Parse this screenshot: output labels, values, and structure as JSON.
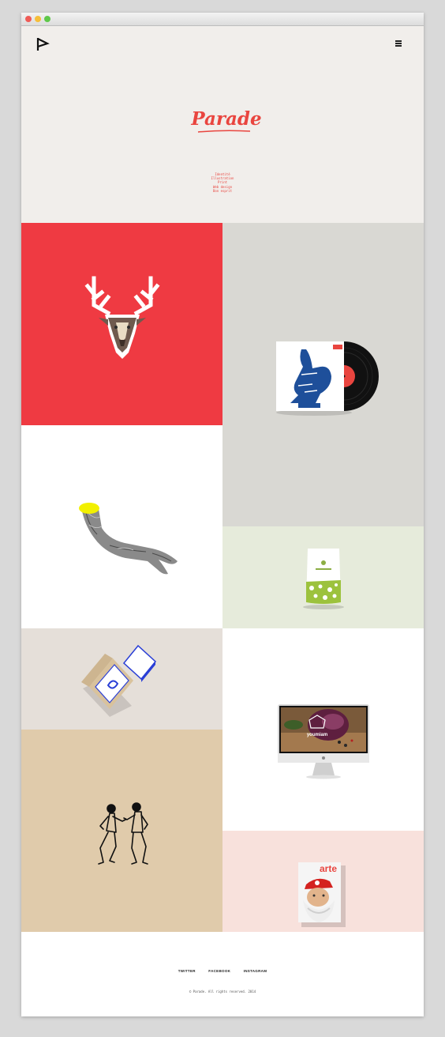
{
  "browser": {
    "buttons": [
      "close",
      "minimize",
      "zoom"
    ]
  },
  "header": {
    "logo_icon": "play-flag-icon",
    "menu_icon": "hamburger-icon",
    "brand": "Parade"
  },
  "services": [
    "Identité",
    "Illustration",
    "Print",
    "Web design",
    "Bon esprit"
  ],
  "portfolio": [
    {
      "id": "deer",
      "icon": "deer-head-icon"
    },
    {
      "id": "vinyl",
      "icon": "vinyl-record-icon"
    },
    {
      "id": "hand",
      "icon": "hand-icon"
    },
    {
      "id": "pouch",
      "icon": "package-pouch-icon"
    },
    {
      "id": "cards",
      "icon": "business-cards-icon"
    },
    {
      "id": "imac",
      "icon": "computer-screen-icon"
    },
    {
      "id": "dance",
      "icon": "dancing-figures-icon"
    },
    {
      "id": "arte",
      "icon": "magazine-cover-icon",
      "text": "arte"
    }
  ],
  "imac_screen_text": "youmiam",
  "footer": {
    "links": [
      "TWITTER",
      "FACEBOOK",
      "INSTAGRAM"
    ],
    "copyright": "© Parade. All rights reserved. 2014"
  },
  "colors": {
    "brand_red": "#e9453f",
    "hero_bg": "#f1eeeb",
    "deer_bg": "#ef3a42",
    "vinyl_bg": "#d9d8d3",
    "pouch_bg": "#e6ebdb",
    "cards_bg": "#e5dfd9",
    "dance_bg": "#e0cbab",
    "arte_bg": "#f8e1dc"
  }
}
